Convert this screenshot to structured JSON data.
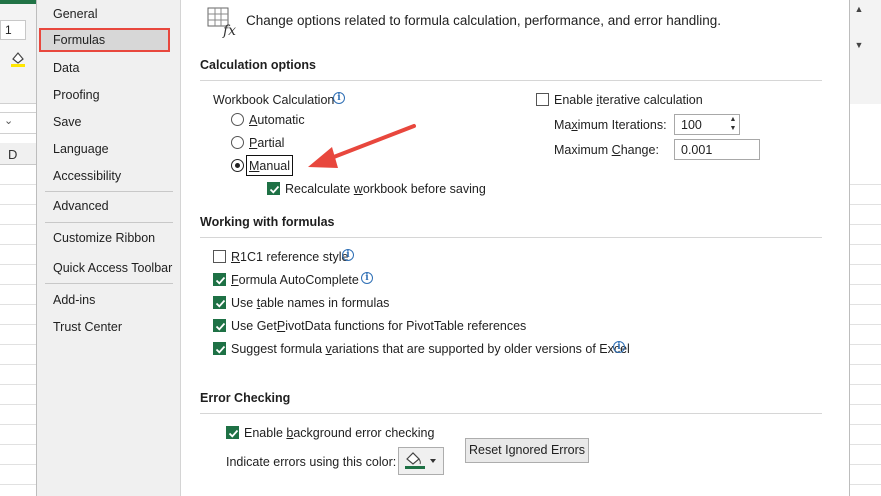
{
  "background_excel": {
    "namebox_value": "1",
    "column_header": "D"
  },
  "nav": {
    "items": [
      {
        "label": "General"
      },
      {
        "label": "Formulas"
      },
      {
        "label": "Data"
      },
      {
        "label": "Proofing"
      },
      {
        "label": "Save"
      },
      {
        "label": "Language"
      },
      {
        "label": "Accessibility"
      },
      {
        "label": "Advanced"
      },
      {
        "label": "Customize Ribbon"
      },
      {
        "label": "Quick Access Toolbar"
      },
      {
        "label": "Add-ins"
      },
      {
        "label": "Trust Center"
      }
    ],
    "selected": "Formulas"
  },
  "header": {
    "description": "Change options related to formula calculation, performance, and error handling."
  },
  "calculation": {
    "title": "Calculation options",
    "workbook_calc_label": "Workbook Calculation",
    "radio_automatic": {
      "pre": "",
      "key": "A",
      "post": "utomatic"
    },
    "radio_partial": {
      "pre": "",
      "key": "P",
      "post": "artial"
    },
    "radio_manual": {
      "pre": "",
      "key": "M",
      "post": "anual"
    },
    "selected": "Manual",
    "recalc": {
      "pre": "Recalculate ",
      "key": "w",
      "post": "orkbook before saving",
      "checked": true
    },
    "iterative": {
      "pre": "Enable ",
      "key": "i",
      "post": "terative calculation",
      "checked": false
    },
    "max_iterations": {
      "pre": "Ma",
      "key": "x",
      "post": "imum Iterations:",
      "value": "100"
    },
    "max_change": {
      "pre": "Maximum ",
      "key": "C",
      "post": "hange:",
      "value": "0.001"
    }
  },
  "formulas": {
    "title": "Working with formulas",
    "r1c1": {
      "pre": "",
      "key": "R",
      "post": "1C1 reference style",
      "checked": false
    },
    "autocomplete": {
      "pre": "",
      "key": "F",
      "post": "ormula AutoComplete",
      "checked": true
    },
    "table_names": {
      "pre": "Use ",
      "key": "t",
      "post": "able names in formulas",
      "checked": true
    },
    "getpivotdata": {
      "pre": "Use Get",
      "key": "P",
      "post": "ivotData functions for PivotTable references",
      "checked": true
    },
    "suggest": {
      "pre": "Suggest formula ",
      "key": "v",
      "post": "ariations that are supported by older versions of Excel",
      "checked": true
    }
  },
  "error_checking": {
    "title": "Error Checking",
    "enable_bg": {
      "pre": "Enable ",
      "key": "b",
      "post": "ackground error checking",
      "checked": true
    },
    "indicate_label": "Indicate errors using this color:",
    "reset_button": {
      "pre": "Reset I",
      "key": "g",
      "post": "nored Errors"
    },
    "indicator_color": "#1e7145"
  },
  "colors": {
    "accent_green": "#1e7145",
    "annotation_red": "#e8473d",
    "info_blue": "#2f6fb5"
  }
}
